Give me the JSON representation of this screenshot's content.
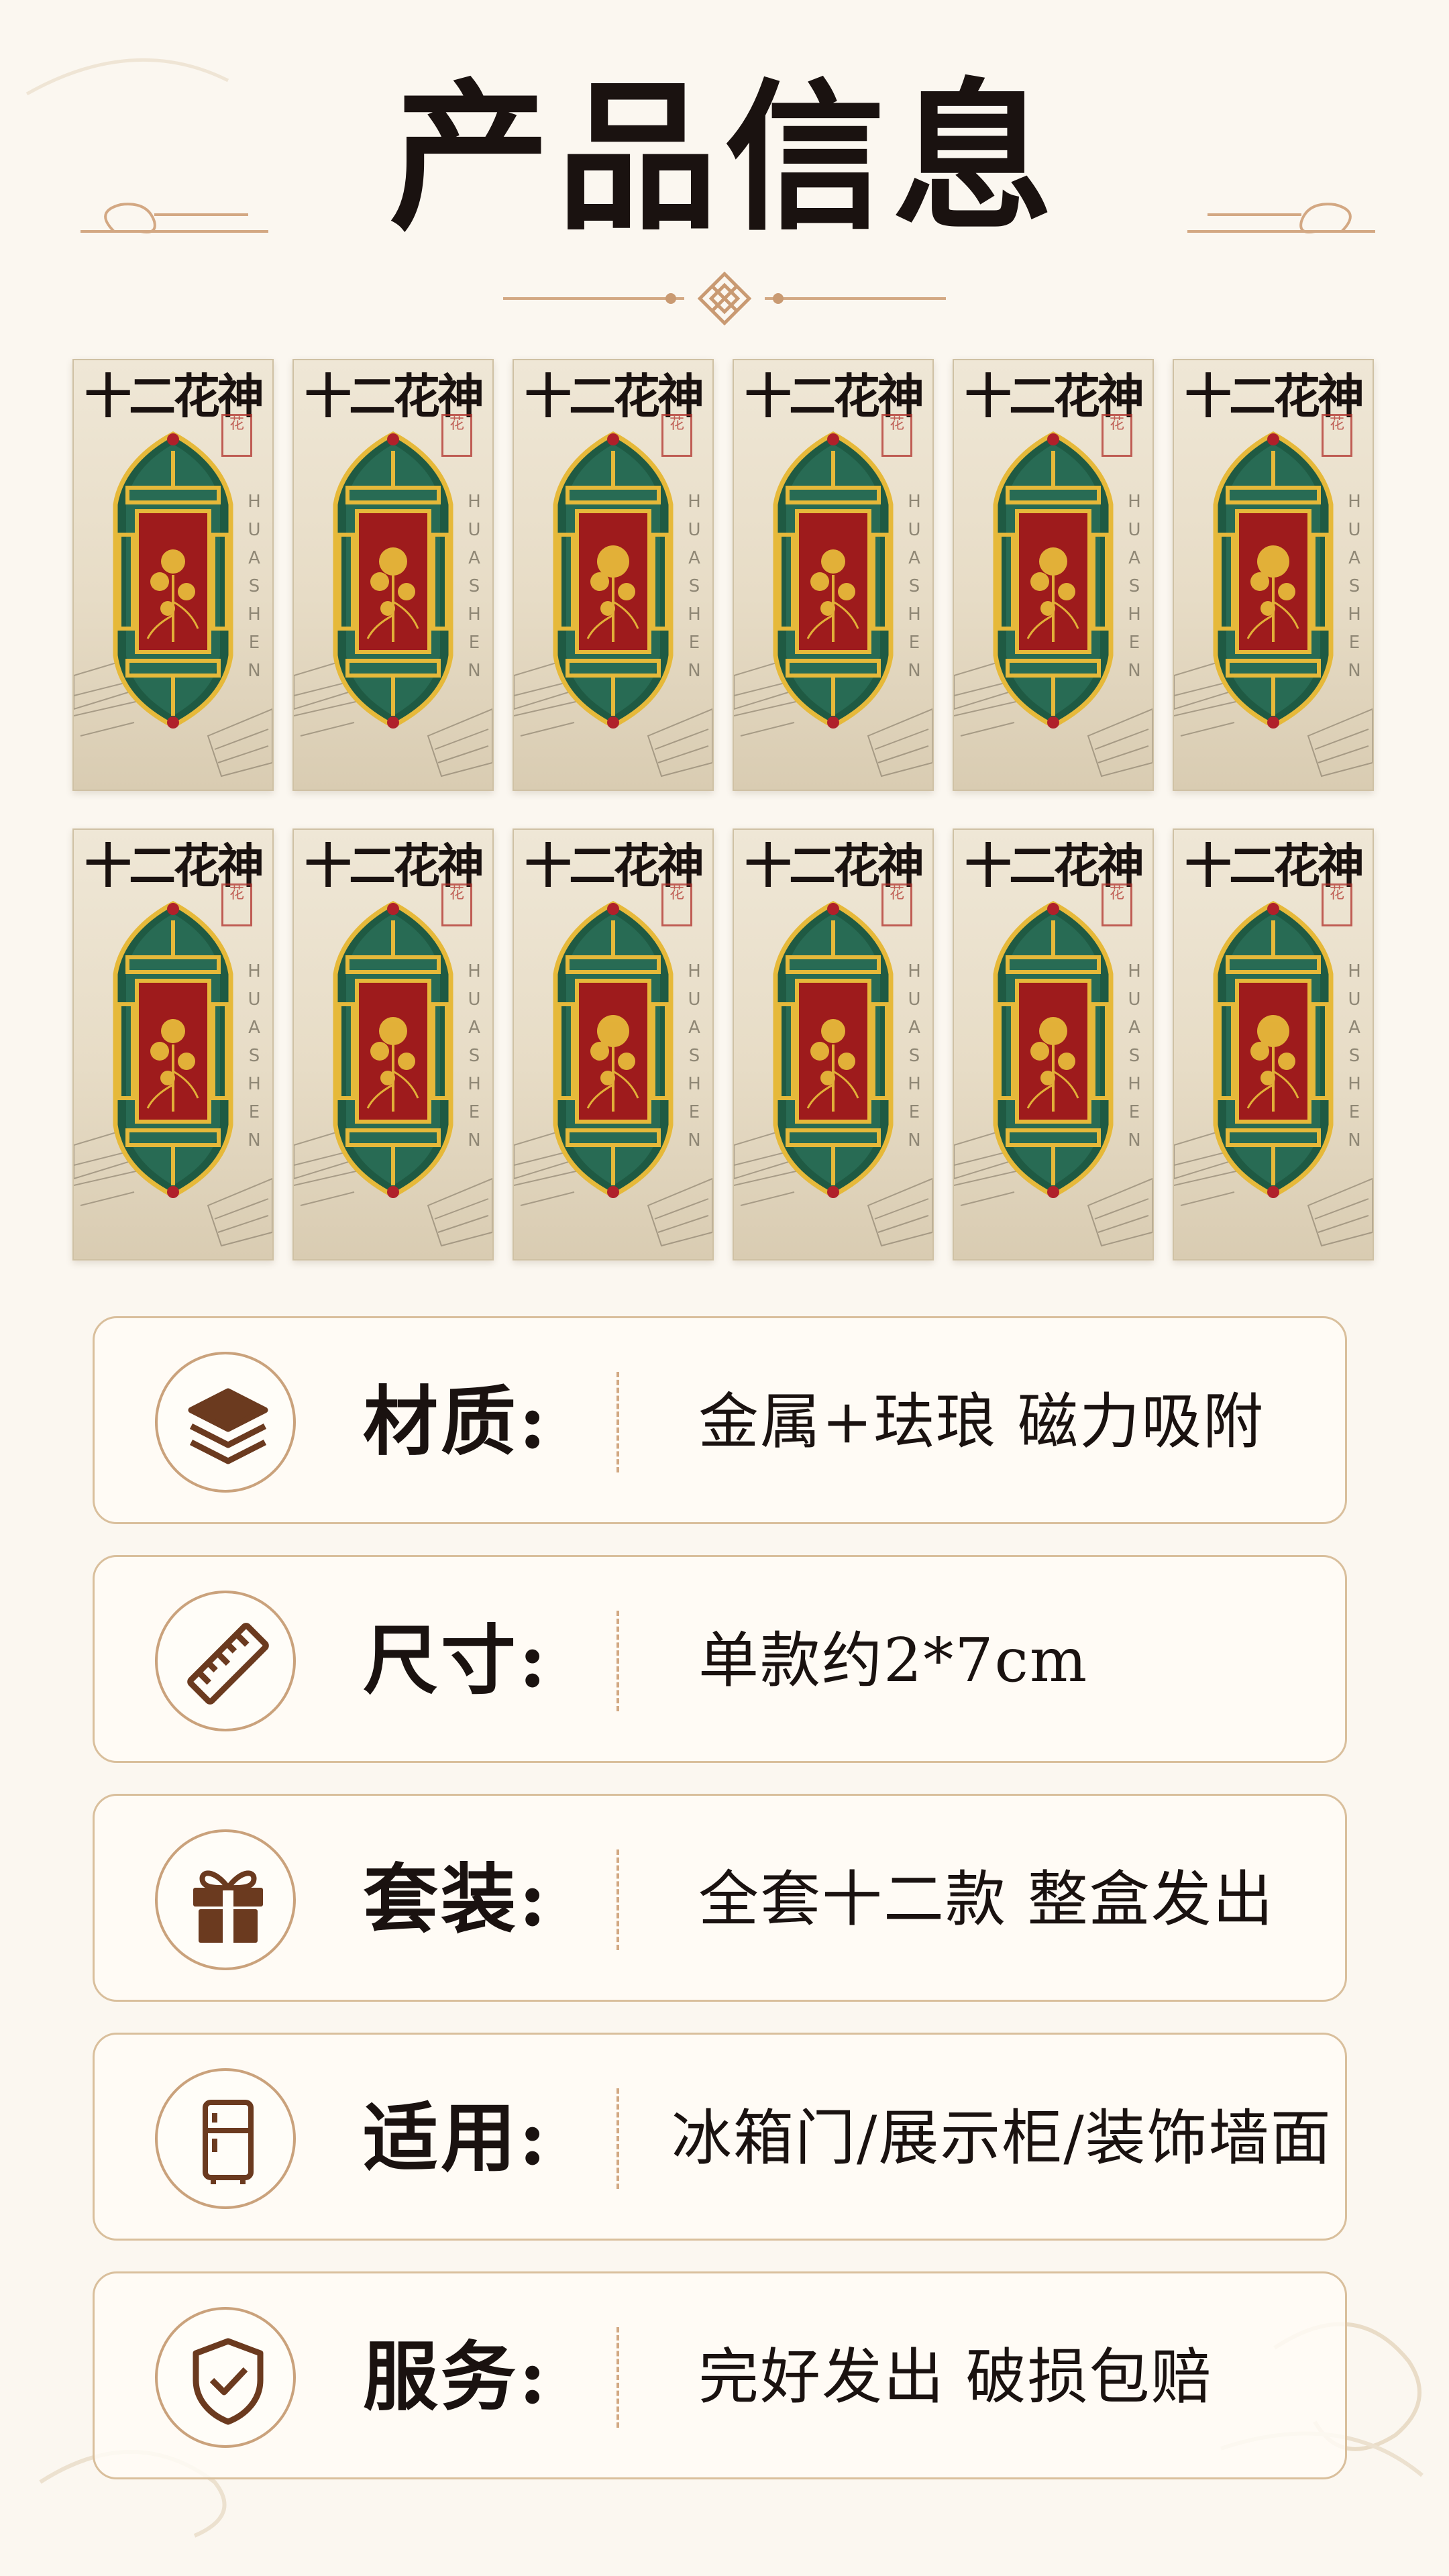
{
  "title": "产品信息",
  "card_title": "十二花神",
  "card_subtitle": "HUASHEN",
  "card_stamp": "花",
  "cards": [
    {
      "bg": "#9e1b1c"
    },
    {
      "bg": "#9e1b1c"
    },
    {
      "bg": "#9e1b1c"
    },
    {
      "bg": "#9e1b1c"
    },
    {
      "bg": "#9e1b1c"
    },
    {
      "bg": "#9e1b1c"
    },
    {
      "bg": "#9e1b1c"
    },
    {
      "bg": "#9e1b1c"
    },
    {
      "bg": "#9e1b1c"
    },
    {
      "bg": "#9e1b1c"
    },
    {
      "bg": "#9e1b1c"
    },
    {
      "bg": "#9e1b1c"
    }
  ],
  "info": [
    {
      "icon": "layers-icon",
      "label": "材质:",
      "value": "金属+珐琅 磁力吸附"
    },
    {
      "icon": "ruler-icon",
      "label": "尺寸:",
      "value": "单款约2*7cm"
    },
    {
      "icon": "gift-icon",
      "label": "套装:",
      "value": "全套十二款 整盒发出"
    },
    {
      "icon": "fridge-icon",
      "label": "适用:",
      "value": "冰箱门/展示柜/装饰墙面"
    },
    {
      "icon": "shield-check-icon",
      "label": "服务:",
      "value": "完好发出 破损包赔"
    }
  ],
  "colors": {
    "accent": "#caa27c",
    "enamel_red": "#9e1b1c",
    "enamel_green": "#1f5a43",
    "gold": "#e6b93a"
  }
}
